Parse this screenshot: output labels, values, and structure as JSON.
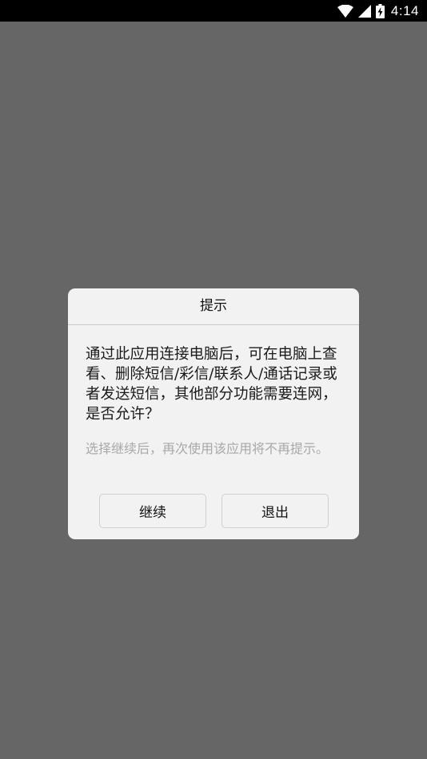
{
  "status_bar": {
    "time": "4:14",
    "icons": [
      "wifi-icon",
      "cell-signal-icon",
      "battery-icon"
    ]
  },
  "dialog": {
    "title": "提示",
    "message": "通过此应用连接电脑后，可在电脑上查看、删除短信/彩信/联系人/通话记录或者发送短信，其他部分功能需要连网，是否允许？",
    "hint": "选择继续后，再次使用该应用将不再提示。",
    "buttons": {
      "continue_label": "继续",
      "exit_label": "退出"
    }
  },
  "colors": {
    "scrim": "#666666",
    "dialog_background": "#f2f2f2",
    "status_bar": "#000000",
    "hint_text": "#a8a8a8"
  }
}
